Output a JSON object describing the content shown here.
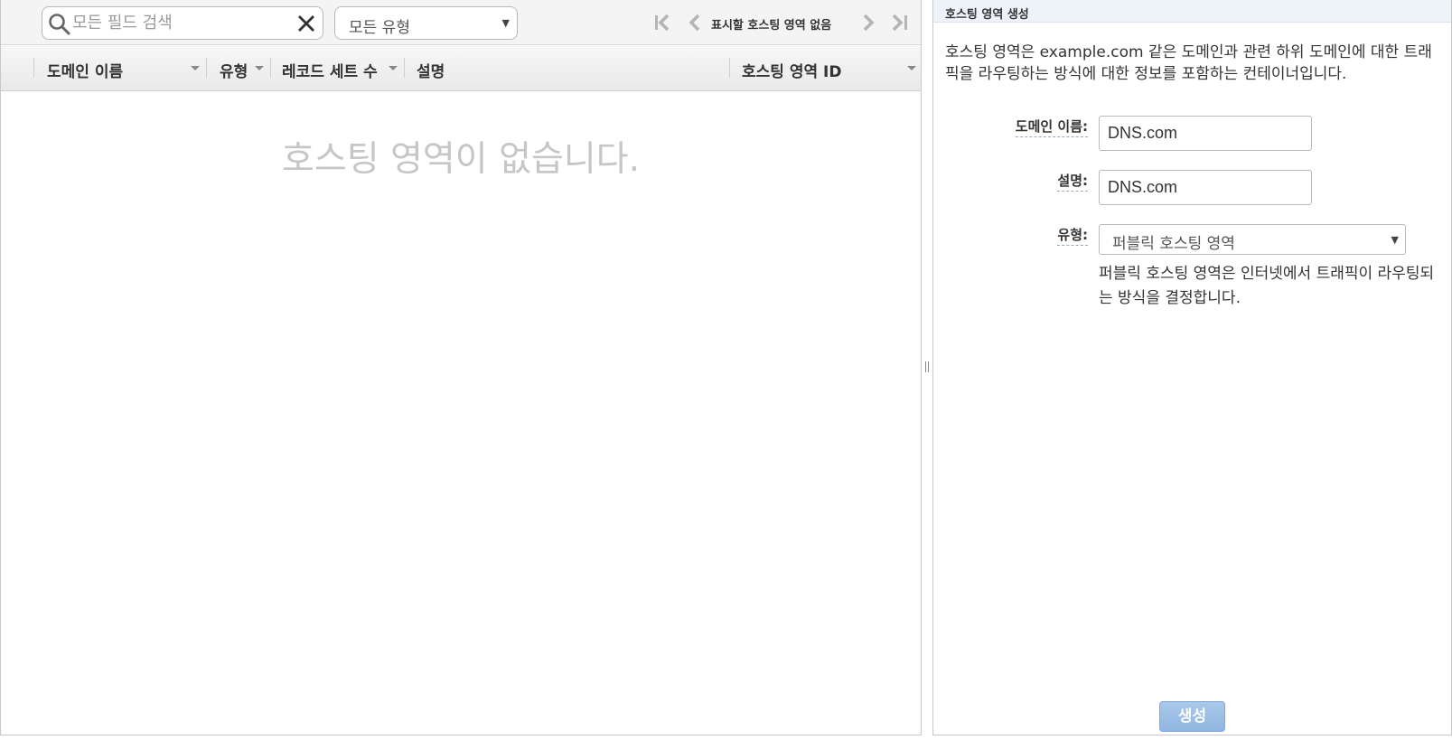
{
  "toolbar": {
    "search_placeholder": "모든 필드 검색",
    "type_filter_value": "모든 유형",
    "pager_text": "표시할 호스팅 영역 없음"
  },
  "table": {
    "columns": [
      "도메인 이름",
      "유형",
      "레코드 세트 수",
      "설명",
      "호스팅 영역 ID"
    ],
    "empty_message": "호스팅 영역이 없습니다."
  },
  "panel": {
    "title": "호스팅 영역 생성",
    "intro": "호스팅 영역은 example.com 같은 도메인과 관련 하위 도메인에 대한 트래픽을 라우팅하는 방식에 대한 정보를 포함하는 컨테이너입니다.",
    "domain_label": "도메인 이름:",
    "domain_value": "DNS.com",
    "desc_label": "설명:",
    "desc_value": "DNS.com",
    "type_label": "유형:",
    "type_value": "퍼블릭 호스팅 영역",
    "type_help": "퍼블릭 호스팅 영역은 인터넷에서 트래픽이 라우팅되는 방식을 결정합니다.",
    "create_label": "생성"
  },
  "colors": {
    "accent_button": "#8fb5e0",
    "empty_text": "#c6c6c6"
  }
}
